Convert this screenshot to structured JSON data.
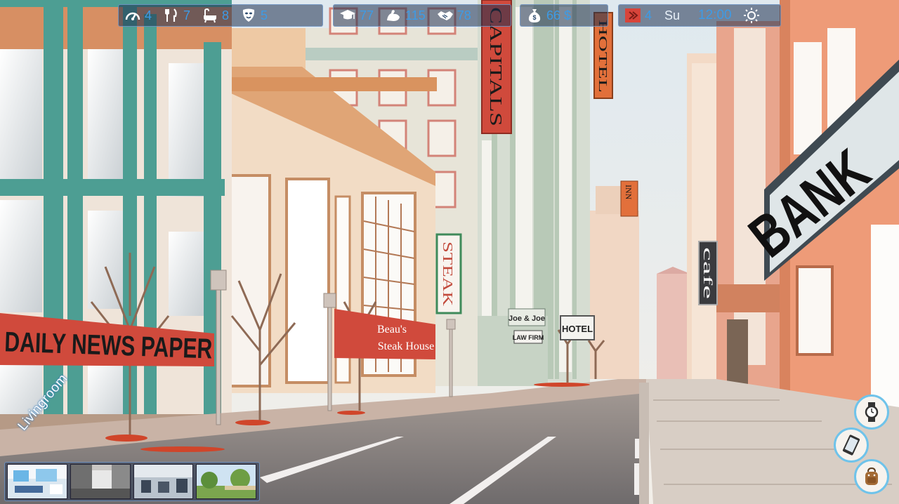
{
  "hud": {
    "needs": [
      {
        "icon": "speedometer-icon",
        "value": "4"
      },
      {
        "icon": "fork-knife-icon",
        "value": "7"
      },
      {
        "icon": "bathtub-icon",
        "value": "8"
      },
      {
        "icon": "mask-icon",
        "value": "5"
      }
    ],
    "skills": [
      {
        "icon": "graduation-cap-icon",
        "value": "77"
      },
      {
        "icon": "flexed-arm-icon",
        "value": "115"
      },
      {
        "icon": "handshake-icon",
        "value": "78"
      }
    ],
    "money": {
      "icon": "money-bag-icon",
      "value": "66 $"
    },
    "time": {
      "icon": "calendar-icon",
      "day_number": "4",
      "weekday": "Su",
      "clock": "12:00",
      "weather_icon": "sun-icon"
    }
  },
  "scene": {
    "signs": {
      "daily_news": "DAILY NEWS PAPER",
      "capitals": "CAPITALS",
      "hotel_vertical": "HOTEL",
      "steak_vertical": "STEAK",
      "beaus_line1": "Beau's",
      "beaus_line2": "Steak House",
      "joe_line1": "Joe & Joe",
      "joe_line2": "LAW FIRM",
      "hotel_small": "HOTEL",
      "inn": "INN",
      "cafe": "cafe",
      "bank": "BANK"
    }
  },
  "location": {
    "label": "Livingroom"
  },
  "thumbnails": [
    {
      "name": "livingroom"
    },
    {
      "name": "street"
    },
    {
      "name": "gym"
    },
    {
      "name": "park"
    }
  ],
  "side_buttons": [
    {
      "icon": "wristwatch-icon"
    },
    {
      "icon": "smartphone-icon"
    },
    {
      "icon": "backpack-icon"
    }
  ],
  "colors": {
    "hud_text": "#3d9be6",
    "hud_border": "#78a0d2",
    "sign_red": "#d04a3c",
    "sky": "#eef3f6"
  }
}
